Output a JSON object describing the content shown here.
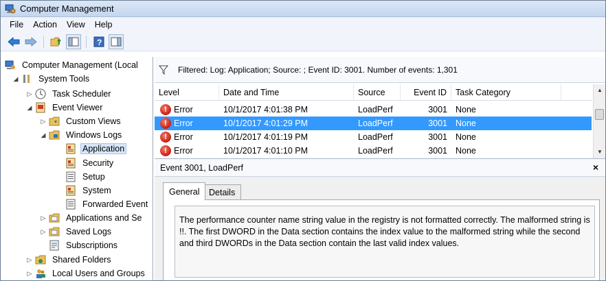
{
  "window": {
    "title": "Computer Management"
  },
  "menu": [
    "File",
    "Action",
    "View",
    "Help"
  ],
  "toolbar": {
    "buttons": [
      "back-arrow-icon",
      "forward-arrow-icon",
      "up-folder-icon",
      "show-hide-tree-icon",
      "help-icon",
      "action-pane-icon"
    ]
  },
  "tree": {
    "root": "Computer Management (Local",
    "system_tools": "System Tools",
    "task_scheduler": "Task Scheduler",
    "event_viewer": "Event Viewer",
    "custom_views": "Custom Views",
    "windows_logs": "Windows Logs",
    "application": "Application",
    "security": "Security",
    "setup": "Setup",
    "system": "System",
    "forwarded_events": "Forwarded Event",
    "applications_and_services": "Applications and Se",
    "saved_logs": "Saved Logs",
    "subscriptions": "Subscriptions",
    "shared_folders": "Shared Folders",
    "local_users_groups": "Local Users and Groups"
  },
  "filter": {
    "text": "Filtered: Log: Application; Source: ; Event ID: 3001. Number of events: 1,301"
  },
  "grid": {
    "headers": {
      "level": "Level",
      "date": "Date and Time",
      "source": "Source",
      "event_id": "Event ID",
      "task": "Task Category"
    },
    "rows": [
      {
        "level": "Error",
        "date": "10/1/2017 4:01:38 PM",
        "source": "LoadPerf",
        "event_id": "3001",
        "task": "None"
      },
      {
        "level": "Error",
        "date": "10/1/2017 4:01:29 PM",
        "source": "LoadPerf",
        "event_id": "3001",
        "task": "None"
      },
      {
        "level": "Error",
        "date": "10/1/2017 4:01:19 PM",
        "source": "LoadPerf",
        "event_id": "3001",
        "task": "None"
      },
      {
        "level": "Error",
        "date": "10/1/2017 4:01:10 PM",
        "source": "LoadPerf",
        "event_id": "3001",
        "task": "None"
      }
    ],
    "selected_index": 1
  },
  "detail": {
    "title": "Event 3001, LoadPerf",
    "close": "×",
    "tab_general": "General",
    "tab_details": "Details",
    "description": "The performance counter name string value in the registry is not formatted correctly. The malformed string is !!. The first DWORD in the Data section contains the index value to the malformed string while the second and third DWORDs in the Data section contain the last valid index values."
  },
  "colors": {
    "selection": "#3399ff",
    "error": "#c71f12",
    "tree_selection": "#d7e6f8"
  }
}
